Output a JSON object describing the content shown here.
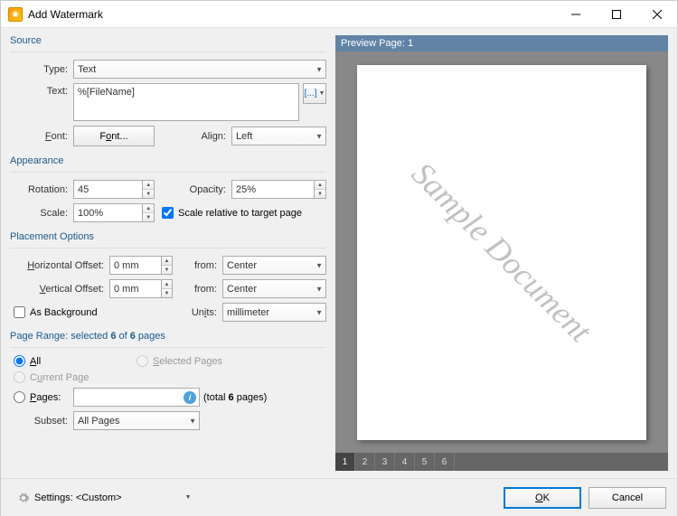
{
  "window": {
    "title": "Add Watermark"
  },
  "source": {
    "title": "Source",
    "type_label": "Type:",
    "type_value": "Text",
    "text_label": "Text:",
    "text_value": "%[FileName]",
    "macro_hint": "[...]",
    "font_label": "Font:",
    "font_btn": "Font...",
    "align_label": "Align:",
    "align_value": "Left"
  },
  "appearance": {
    "title": "Appearance",
    "rotation_label": "Rotation:",
    "rotation_value": "45",
    "opacity_label": "Opacity:",
    "opacity_value": "25%",
    "scale_label": "Scale:",
    "scale_value": "100%",
    "relative_label": "Scale relative to target page",
    "relative_checked": true
  },
  "placement": {
    "title": "Placement Options",
    "hoff_label": "Horizontal Offset:",
    "hoff_value": "0 mm",
    "hfrom_label": "from:",
    "hfrom_value": "Center",
    "voff_label": "Vertical Offset:",
    "voff_value": "0 mm",
    "vfrom_label": "from:",
    "vfrom_value": "Center",
    "bg_label": "As Background",
    "units_label": "Units:",
    "units_value": "millimeter"
  },
  "range": {
    "title": "Page Range: selected 6 of 6 pages",
    "all": "All",
    "selected_pages": "Selected Pages",
    "current": "Current Page",
    "pages": "Pages:",
    "pages_value": "",
    "total": "(total 6 pages)",
    "subset_label": "Subset:",
    "subset_value": "All Pages"
  },
  "preview": {
    "title": "Preview Page: 1",
    "watermark_text": "Sample Document",
    "tabs": [
      "1",
      "2",
      "3",
      "4",
      "5",
      "6"
    ],
    "active_tab": 0
  },
  "footer": {
    "settings_label": "Settings:",
    "settings_value": "<Custom>",
    "ok": "OK",
    "cancel": "Cancel"
  }
}
